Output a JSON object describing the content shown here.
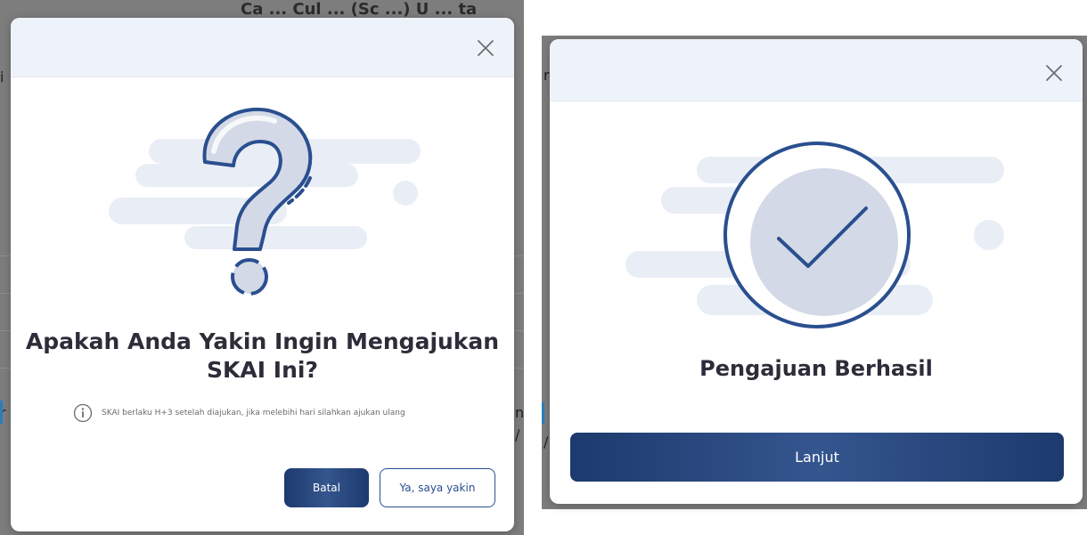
{
  "background_page": {
    "title_fragment": "Ca ... Cul ... (Sc ...) U ... ta",
    "left_fragments": [
      "r",
      "i",
      "r",
      "/"
    ],
    "right_fragments": [
      "n,",
      "/",
      "r",
      "/"
    ]
  },
  "confirm_dialog": {
    "icon": "question-illustration",
    "close_icon": "close-icon",
    "title_line1": "Apakah Anda Yakin Ingin Mengajukan",
    "title_line2": "SKAI Ini?",
    "note_icon": "info-icon",
    "note": "SKAI berlaku H+3 setelah diajukan, jika melebihi hari silahkan ajukan ulang",
    "cancel_label": "Batal",
    "confirm_label": "Ya, saya yakin"
  },
  "success_dialog": {
    "icon": "checkmark-illustration",
    "close_icon": "close-icon",
    "title": "Pengajuan Berhasil",
    "continue_label": "Lanjut"
  },
  "colors": {
    "primary": "#1d3a6e",
    "header_bg": "#eef3fb",
    "illustration_stroke": "#2a4f8f",
    "illustration_fill": "#d3d9e6",
    "cloud": "#e9eef6"
  }
}
